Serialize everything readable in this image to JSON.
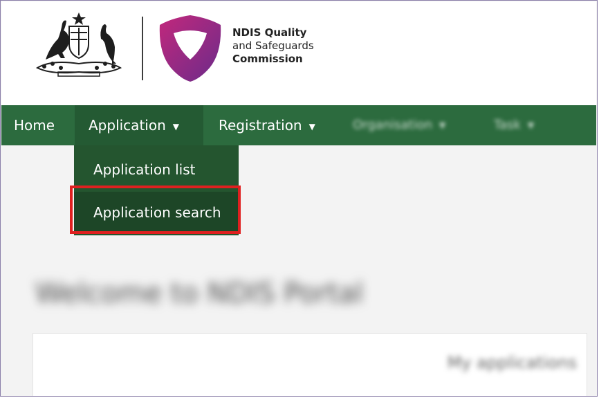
{
  "header": {
    "brand_line1": "NDIS Quality",
    "brand_line2": "and Safeguards",
    "brand_line3": "Commission"
  },
  "nav": {
    "items": [
      {
        "label": "Home"
      },
      {
        "label": "Application"
      },
      {
        "label": "Registration"
      },
      {
        "label": "Organisation"
      },
      {
        "label": "Task"
      }
    ],
    "caret_icon": "caret-down-icon"
  },
  "dropdown": {
    "items": [
      {
        "label": "Application list"
      },
      {
        "label": "Application search"
      }
    ],
    "highlighted": "Application search"
  },
  "content": {
    "welcome_blurred": "Welcome to NDIS Portal",
    "panel_label_blurred": "My applications"
  },
  "colors": {
    "navbar": "#2c6b3e",
    "dropdown": "#24552f",
    "highlight_border": "#e02020",
    "logo_magenta": "#b3267a",
    "logo_purple": "#6b2b8a"
  }
}
